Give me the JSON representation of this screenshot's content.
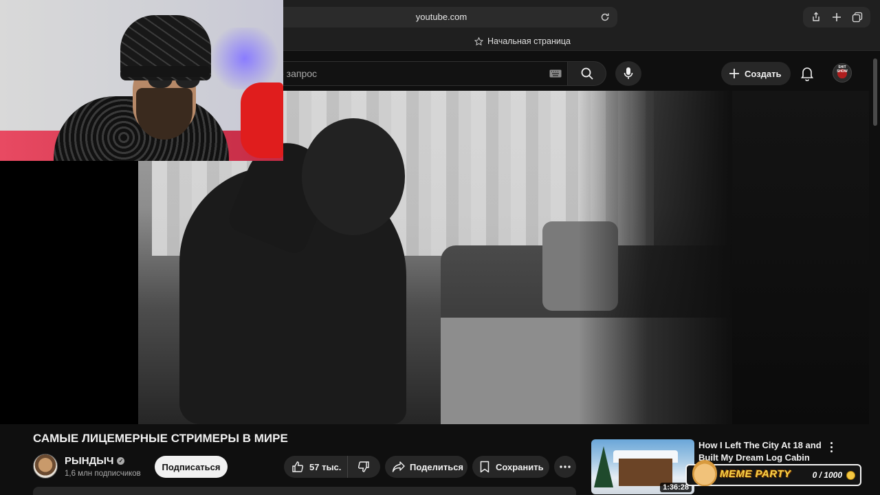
{
  "browser": {
    "url": "youtube.com",
    "bookmark_label": "Начальная страница"
  },
  "header": {
    "search_placeholder": "е запрос",
    "create_label": "Создать",
    "avatar_text": "SHIT SHOW"
  },
  "video": {
    "title": "САМЫЕ ЛИЦЕМЕРНЫЕ СТРИМЕРЫ В МИРЕ",
    "channel_name": "РЫНДЫЧ",
    "subscribers": "1,6 млн подписчиков",
    "subscribe_label": "Подписаться",
    "likes": "57 тыс.",
    "share_label": "Поделиться",
    "save_label": "Сохранить"
  },
  "recommendation": {
    "title": "How I Left The City At 18 and Built My Dream Log Cabin",
    "duration": "1:36:28"
  },
  "overlay": {
    "title": "MEME PARTY",
    "score": "0 / 1000"
  },
  "colors": {
    "background": "#0f0f0f",
    "surface": "#272727",
    "text": "#f1f1f1",
    "muted": "#aaaaaa",
    "meme_yellow": "#f9d54a"
  }
}
